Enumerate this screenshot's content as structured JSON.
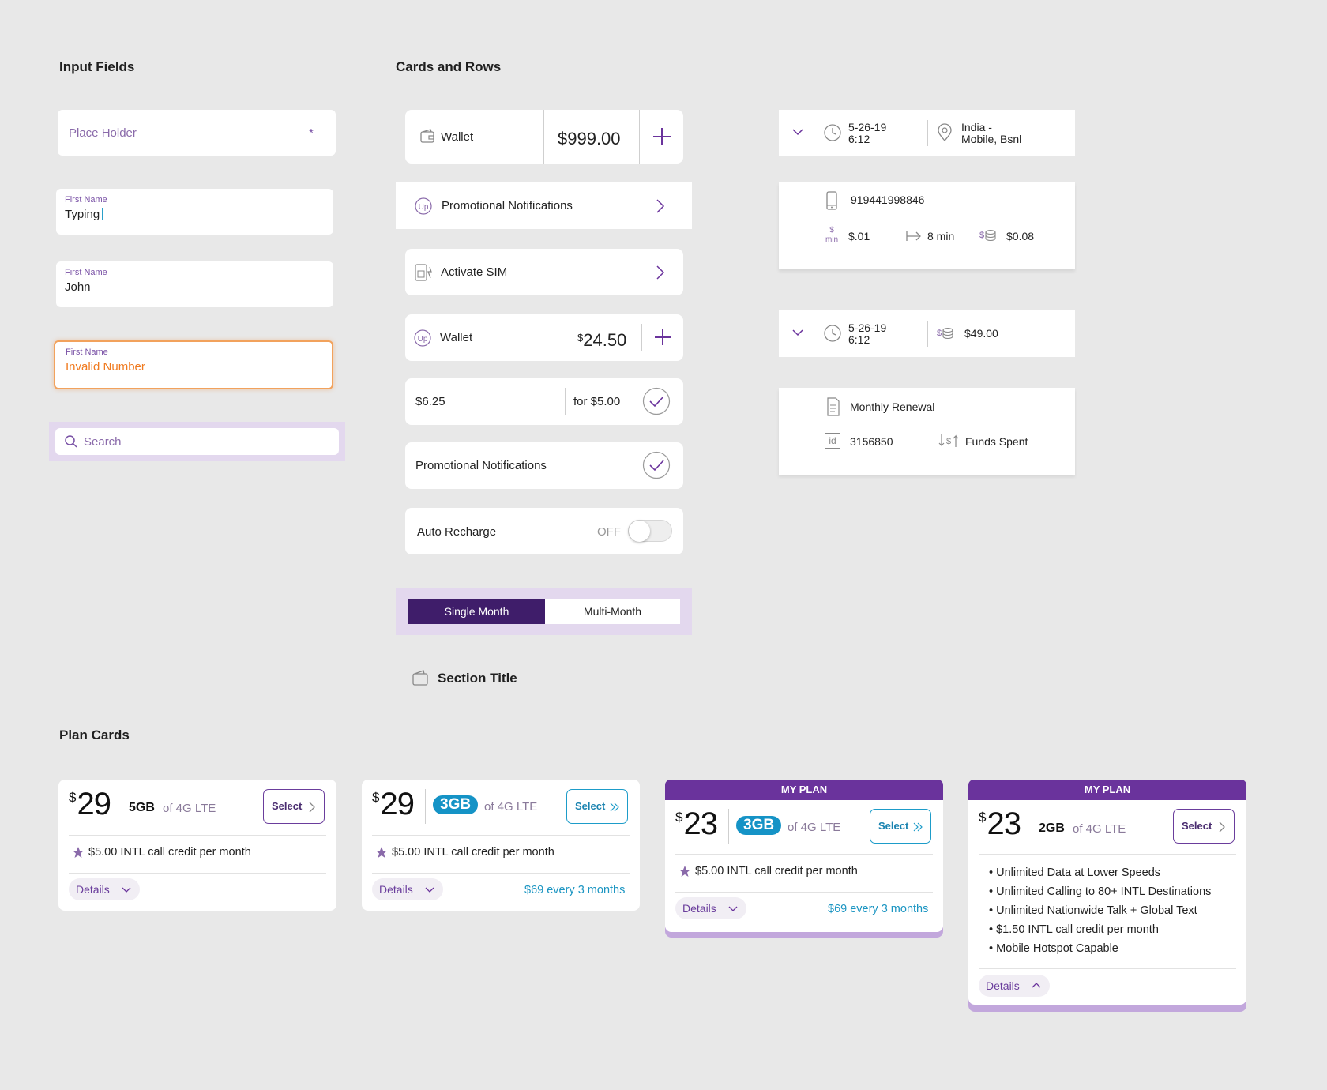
{
  "sections": {
    "inputs_title": "Input Fields",
    "cards_title": "Cards and Rows",
    "plans_title": "Plan Cards"
  },
  "inputs": {
    "placeholder_text": "Place Holder",
    "required_mark": "*",
    "typing_label": "First Name",
    "typing_value": "Typing",
    "filled_label": "First Name",
    "filled_value": "John",
    "error_label": "First Name",
    "error_value": "Invalid Number",
    "search_placeholder": "Search"
  },
  "rows": {
    "wallet1_label": "Wallet",
    "wallet1_amount": "$999.00",
    "promo1_label": "Promotional Notifications",
    "activate_label": "Activate SIM",
    "wallet2_label": "Wallet",
    "wallet2_currency": "$",
    "wallet2_amount": "24.50",
    "offer_amount": "$6.25",
    "offer_price": "for $5.00",
    "promo2_label": "Promotional Notifications",
    "auto_label": "Auto Recharge",
    "auto_state": "OFF",
    "seg_single": "Single Month",
    "seg_multi": "Multi-Month",
    "section_title": "Section Title"
  },
  "history": {
    "call_date": "5-26-19",
    "call_time": "6:12",
    "call_location_1": "India -",
    "call_location_2": "Mobile, Bsnl",
    "phone": "919441998846",
    "rate_top": "$",
    "rate_bottom": "min",
    "rate": "$.01",
    "duration": "8 min",
    "cost_sign": "$",
    "cost": "$0.08",
    "tx_date": "5-26-19",
    "tx_time": "6:12",
    "tx_sign": "$",
    "tx_amount": "$49.00",
    "renewal": "Monthly Renewal",
    "id_tag": "id",
    "id_value": "3156850",
    "funds": "Funds Spent"
  },
  "plans": [
    {
      "header": "",
      "currency": "$",
      "price": "29",
      "data": "5GB",
      "data_style": "plain",
      "of": "of 4G LTE",
      "select": "Select",
      "credit": "$5.00 INTL call credit per month",
      "details": "Details",
      "every": ""
    },
    {
      "header": "",
      "currency": "$",
      "price": "29",
      "data": "3GB",
      "data_style": "pill",
      "of": "of 4G LTE",
      "select": "Select",
      "credit": "$5.00 INTL call credit per month",
      "details": "Details",
      "every": "$69 every 3 months"
    },
    {
      "header": "MY PLAN",
      "currency": "$",
      "price": "23",
      "data": "3GB",
      "data_style": "pill",
      "of": "of 4G LTE",
      "select": "Select",
      "credit": "$5.00 INTL call credit per month",
      "details": "Details",
      "every": "$69 every 3 months"
    },
    {
      "header": "MY PLAN",
      "currency": "$",
      "price": "23",
      "data": "2GB",
      "data_style": "plain",
      "of": "of 4G LTE",
      "select": "Select",
      "bullets": [
        "Unlimited Data at Lower Speeds",
        "Unlimited Calling to 80+ INTL Destinations",
        "Unlimited Nationwide Talk + Global Text",
        "$1.50 INTL call credit per month",
        "Mobile Hotspot Capable"
      ],
      "details": "Details"
    }
  ],
  "colors": {
    "brand_purple": "#6a339c",
    "accent_blue": "#1593c6",
    "error_orange": "#f07a1f",
    "background": "#e8e8e8"
  }
}
